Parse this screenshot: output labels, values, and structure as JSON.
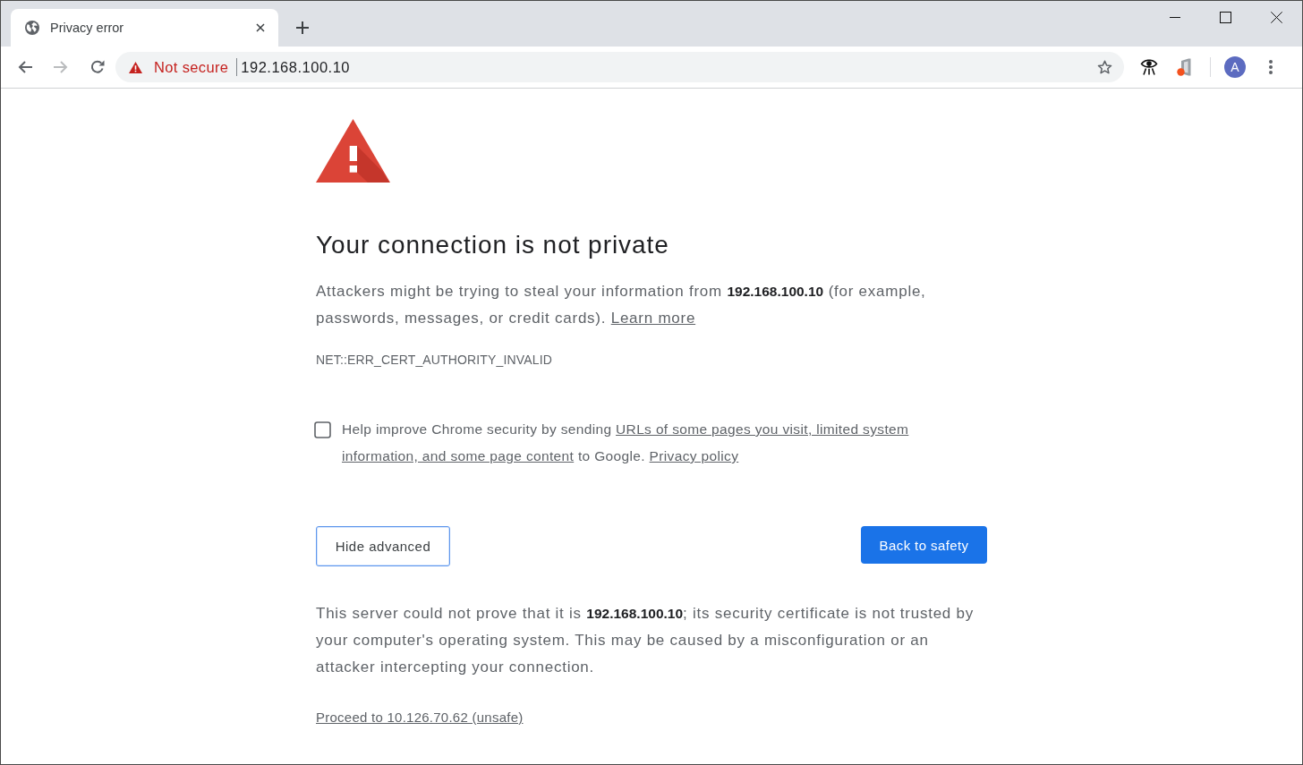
{
  "tabs": [
    {
      "title": "Privacy error",
      "selected": true
    }
  ],
  "toolbar": {
    "nav_buttons": [
      {
        "kind": "back",
        "disabled": false
      },
      {
        "kind": "forward",
        "disabled": true
      },
      {
        "kind": "reload",
        "disabled": false
      }
    ],
    "security_chip": "Not secure",
    "url": "192.168.100.10",
    "profile_initial": "A"
  },
  "interstitial": {
    "heading": "Your connection is not private",
    "message": {
      "text": "Attackers might be trying to steal your information from **192.168.100.10** (for example, passwords, messages, or credit cards).",
      "link": "Learn more"
    },
    "error_code": "NET::ERR_CERT_AUTHORITY_INVALID",
    "reporting": {
      "checked": false,
      "parts": [
        {
          "kind": "text",
          "text": "Help improve Chrome security by sending"
        },
        {
          "kind": "link",
          "text": "URLs of some pages you visit, limited system"
        },
        {
          "kind": "link",
          "text": "information, and some page content"
        },
        {
          "kind": "text",
          "text": "to Google."
        },
        {
          "kind": "link",
          "text": "Privacy policy"
        }
      ]
    },
    "buttons": [
      {
        "label": "Hide advanced",
        "kind": "secondary"
      },
      {
        "label": "Back to safety",
        "kind": "primary"
      }
    ],
    "details": "This server could not prove that it is **192.168.100.10**; its security certificate is not trusted by your computer's operating system. This may be caused by a misconfiguration or an attacker intercepting your connection.",
    "proceed_link": "Proceed to 10.126.70.62 (unsafe)"
  }
}
